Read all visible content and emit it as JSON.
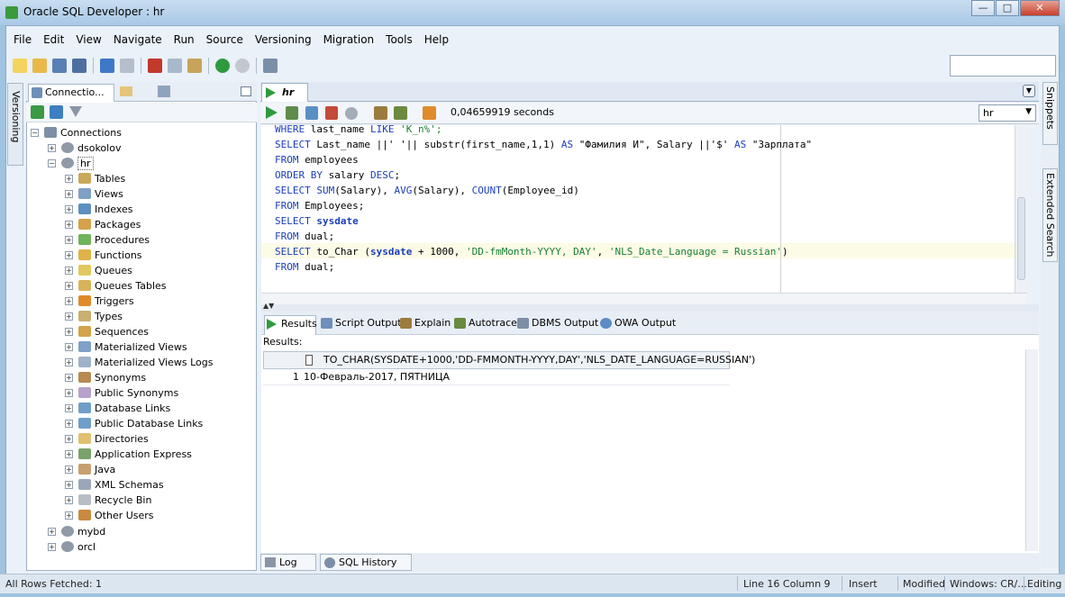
{
  "window": {
    "title": "Oracle SQL Developer : hr",
    "min": "—",
    "max": "□",
    "close": "✕"
  },
  "menu": [
    "File",
    "Edit",
    "View",
    "Navigate",
    "Run",
    "Source",
    "Versioning",
    "Migration",
    "Tools",
    "Help"
  ],
  "left": {
    "side_tab": "Versioning",
    "tab_connections": "Connectio...",
    "tree": {
      "root": "Connections",
      "dsokolov": "dsokolov",
      "hr": "hr",
      "items": [
        "Tables",
        "Views",
        "Indexes",
        "Packages",
        "Procedures",
        "Functions",
        "Queues",
        "Queues Tables",
        "Triggers",
        "Types",
        "Sequences",
        "Materialized Views",
        "Materialized Views Logs",
        "Synonyms",
        "Public Synonyms",
        "Database Links",
        "Public Database Links",
        "Directories",
        "Application Express",
        "Java",
        "XML Schemas",
        "Recycle Bin",
        "Other Users"
      ],
      "mybd": "mybd",
      "orcl": "orcl"
    }
  },
  "editor": {
    "tab": "hr",
    "elapsed": "0,04659919 seconds",
    "connection": "hr",
    "lines": {
      "l0a": "WHERE",
      "l0b": " last_name ",
      "l0c": "LIKE",
      "l0d": " 'K_n%';",
      "l1a": "SELECT",
      "l1b": " Last_name ||' '|| substr(first_name,1,1) ",
      "l1c": "AS",
      "l1d": " \"Фамилия И\", Salary ||'$' ",
      "l1e": "AS",
      "l1f": " \"Зарплата\"",
      "l2a": "FROM",
      "l2b": " employees",
      "l3a": "ORDER BY",
      "l3b": " salary ",
      "l3c": "DESC",
      "l3d": ";",
      "l4a": "SELECT",
      "l4b": " ",
      "l4c": "SUM",
      "l4d": "(Salary), ",
      "l4e": "AVG",
      "l4f": "(Salary), ",
      "l4g": "COUNT",
      "l4h": "(Employee_id)",
      "l5a": "FROM",
      "l5b": " Employees;",
      "l6a": "SELECT",
      "l6b": " ",
      "l6c": "sysdate",
      "l7a": "FROM",
      "l7b": " dual;",
      "l8a": "SELECT",
      "l8b": " to_Char (",
      "l8c": "sysdate",
      "l8d": " + 1000, ",
      "l8e": "'DD-fmMonth-YYYY, DAY'",
      "l8f": ", ",
      "l8g": "'NLS_Date_Language = Russian'",
      "l8h": ")",
      "l9a": "FROM",
      "l9b": " dual;"
    }
  },
  "results": {
    "tabs": [
      "Results",
      "Script Output",
      "Explain",
      "Autotrace",
      "DBMS Output",
      "OWA Output"
    ],
    "label": "Results:",
    "column": "TO_CHAR(SYSDATE+1000,'DD-FMMONTH-YYYY,DAY','NLS_DATE_LANGUAGE=RUSSIAN')",
    "row_num": "1",
    "row_value": "10-Февраль-2017, ПЯТНИЦА"
  },
  "bottom_tabs": [
    "Log",
    "SQL History"
  ],
  "right_tabs": [
    "Snippets",
    "Extended Search"
  ],
  "status": {
    "left": "All Rows Fetched: 1",
    "position": "Line 16 Column 9",
    "mode": "Insert",
    "modified": "Modified",
    "eol": "Windows: CR/...",
    "state": "Editing"
  }
}
